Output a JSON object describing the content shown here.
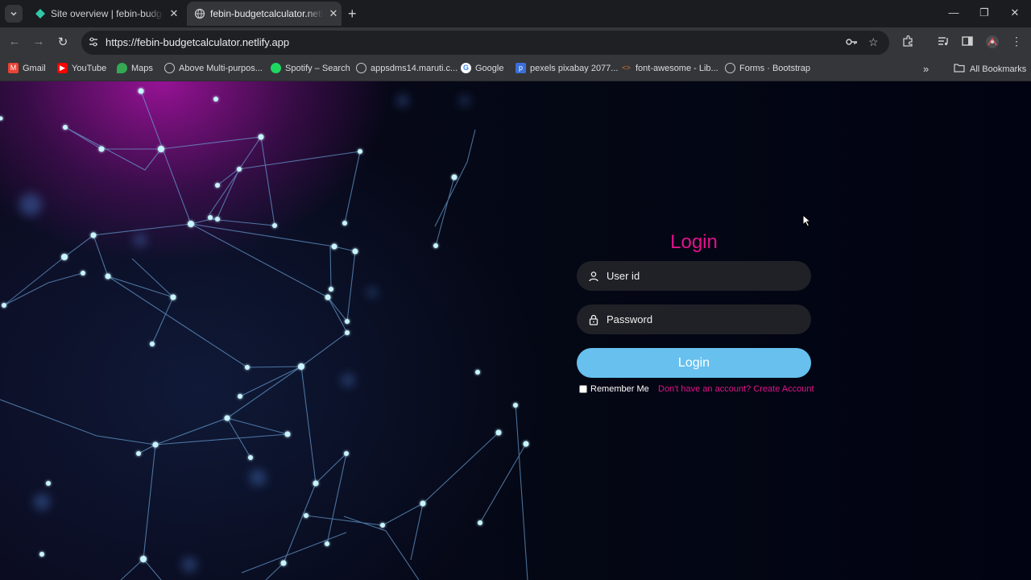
{
  "browser": {
    "tabs": [
      {
        "title": "Site overview | febin-budgetcalc"
      },
      {
        "title": "febin-budgetcalculator.netlify.app"
      }
    ],
    "url": "https://febin-budgetcalculator.netlify.app",
    "bookmarks": [
      {
        "label": "Gmail",
        "icon": "gmail-icon"
      },
      {
        "label": "YouTube",
        "icon": "youtube-icon"
      },
      {
        "label": "Maps",
        "icon": "maps-icon"
      },
      {
        "label": "Above Multi-purpos...",
        "icon": "globe-icon"
      },
      {
        "label": "Spotify – Search",
        "icon": "spotify-icon"
      },
      {
        "label": "appsdms14.maruti.c...",
        "icon": "globe-icon"
      },
      {
        "label": "Google",
        "icon": "google-icon"
      },
      {
        "label": "pexels pixabay 2077...",
        "icon": "pexels-icon"
      },
      {
        "label": "font-awesome - Lib...",
        "icon": "code-icon"
      },
      {
        "label": "Forms · Bootstrap",
        "icon": "globe-icon"
      }
    ],
    "all_bookmarks": "All Bookmarks"
  },
  "login": {
    "title": "Login",
    "user_placeholder": "User id",
    "password_placeholder": "Password",
    "button": "Login",
    "remember": "Remember Me",
    "create_account": "Don't have an account? Create Account"
  },
  "colors": {
    "accent_pink": "#e0128a",
    "button_blue": "#67c0ee",
    "background": "#020515"
  }
}
